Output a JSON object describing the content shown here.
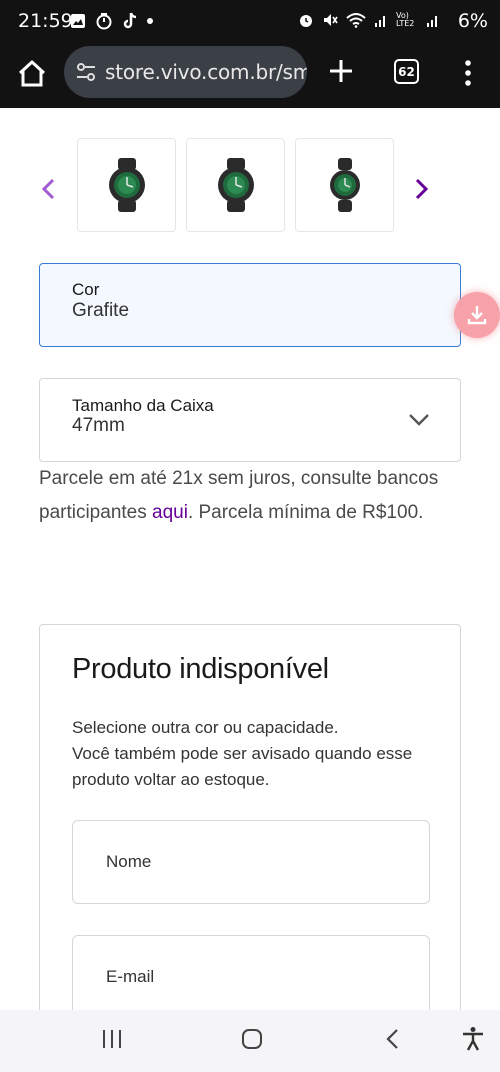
{
  "status_bar": {
    "time": "21:59",
    "battery": "6%",
    "left_icons": [
      "image-icon",
      "timer-icon",
      "tiktok-icon",
      "notification-dot-icon"
    ],
    "right_icons": [
      "alarm-icon",
      "mute-icon",
      "wifi-icon",
      "signal-icon",
      "volte-icon",
      "signal-icon"
    ],
    "volte_label": "Vo) LTE2"
  },
  "browser": {
    "url": "store.vivo.com.br/smar",
    "tab_count": "62"
  },
  "gallery": {
    "prev_icon": "chevron-left-icon",
    "next_icon": "chevron-right-icon",
    "thumbnails": [
      "watch-thumbnail",
      "watch-thumbnail",
      "watch-thumbnail"
    ]
  },
  "product_options": {
    "color": {
      "label": "Cor",
      "value": "Grafite"
    },
    "size": {
      "label": "Tamanho da Caixa",
      "value": "47mm"
    }
  },
  "installments": {
    "text_before": "Parcele em até 21x sem juros, consulte bancos participantes ",
    "link": "aqui",
    "text_after": ". Parcela mínima de R$100."
  },
  "unavailable": {
    "title": "Produto indisponível",
    "description_line1": "Selecione outra cor ou capacidade.",
    "description_line2": "Você também pode ser avisado quando esse produto voltar ao estoque.",
    "name_placeholder": "Nome",
    "email_placeholder": "E-mail"
  },
  "colors": {
    "accent_purple": "#660099",
    "focus_blue": "#3a7bd5",
    "download_fab": "#f7a1a8"
  }
}
